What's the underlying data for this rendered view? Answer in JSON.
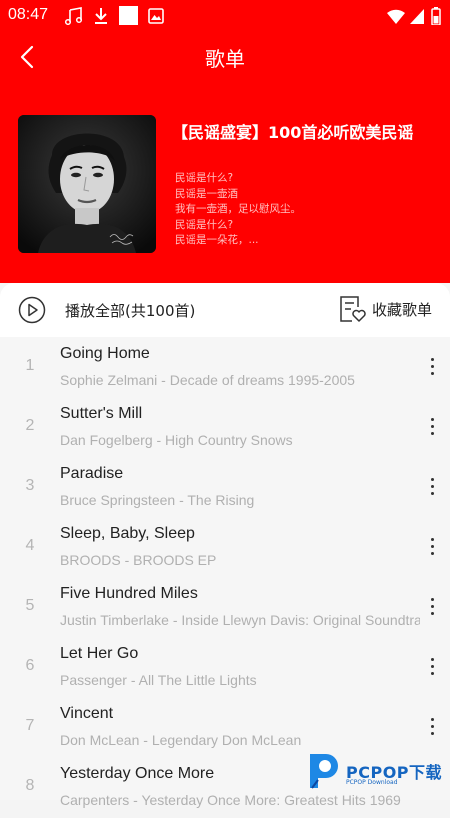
{
  "status_bar": {
    "time": "08:47",
    "left_icons": [
      "music-note-icon",
      "download-icon",
      "white-square-icon",
      "picture-icon"
    ],
    "right_icons": [
      "wifi-icon",
      "signal-icon",
      "battery-icon"
    ]
  },
  "header": {
    "title": "歌单",
    "back_icon": "chevron-left-icon"
  },
  "playlist": {
    "title": "【民谣盛宴】100首必听欧美民谣",
    "description_lines": [
      "民谣是什么?",
      "民谣是一壶酒",
      "我有一壶酒，足以慰风尘。",
      "民谣是什么?",
      "民谣是一朵花，..."
    ]
  },
  "actions": {
    "play_all_label": "播放全部(共100首)",
    "collect_label": "收藏歌单"
  },
  "songs": [
    {
      "num": "1",
      "title": "Going Home",
      "subtitle": "Sophie Zelmani - Decade of dreams 1995-2005"
    },
    {
      "num": "2",
      "title": "Sutter's Mill",
      "subtitle": "Dan Fogelberg - High Country Snows"
    },
    {
      "num": "3",
      "title": "Paradise",
      "subtitle": "Bruce Springsteen - The Rising"
    },
    {
      "num": "4",
      "title": "Sleep, Baby, Sleep",
      "subtitle": "BROODS - BROODS EP"
    },
    {
      "num": "5",
      "title": "Five Hundred Miles",
      "subtitle": "Justin Timberlake - Inside Llewyn Davis: Original Soundtrack"
    },
    {
      "num": "6",
      "title": "Let Her Go",
      "subtitle": "Passenger - All The Little Lights"
    },
    {
      "num": "7",
      "title": "Vincent",
      "subtitle": "Don McLean - Legendary Don McLean"
    },
    {
      "num": "8",
      "title": "Yesterday Once More",
      "subtitle": "Carpenters - Yesterday Once More: Greatest Hits 1969"
    }
  ],
  "watermark": {
    "text": "PCPOP下载",
    "subtext": "PCPOP Download"
  },
  "colors": {
    "header_bg": "#ff0000",
    "accent_blue": "#1565c0"
  }
}
